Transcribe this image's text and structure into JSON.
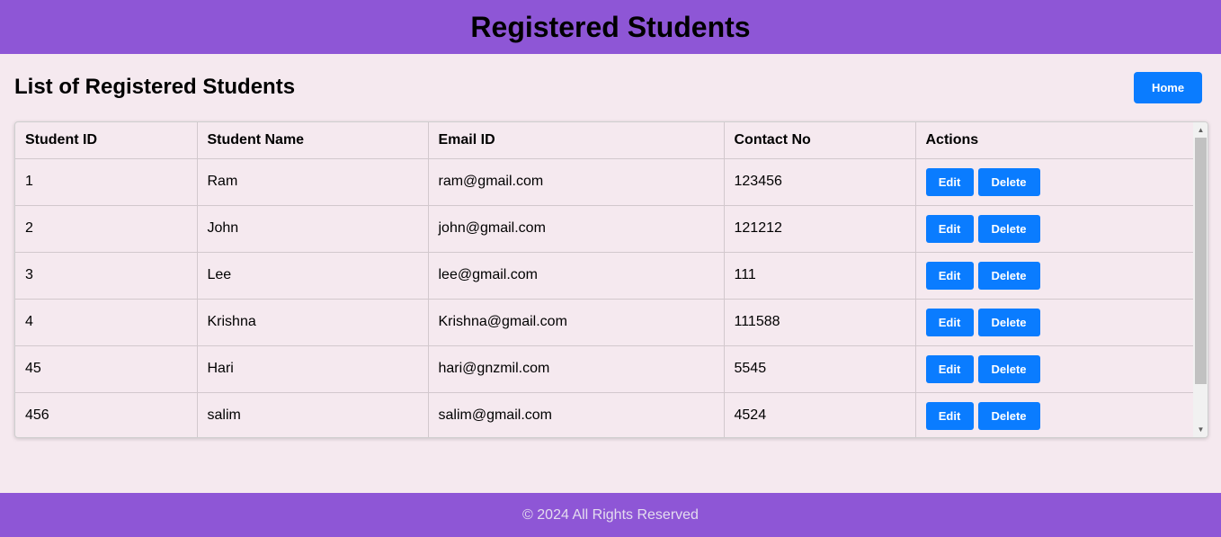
{
  "header": {
    "title": "Registered Students"
  },
  "section": {
    "title": "List of Registered Students",
    "home_label": "Home"
  },
  "table": {
    "columns": [
      "Student ID",
      "Student Name",
      "Email ID",
      "Contact No",
      "Actions"
    ],
    "rows": [
      {
        "id": "1",
        "name": "Ram",
        "email": "ram@gmail.com",
        "contact": "123456"
      },
      {
        "id": "2",
        "name": "John",
        "email": "john@gmail.com",
        "contact": "121212"
      },
      {
        "id": "3",
        "name": "Lee",
        "email": "lee@gmail.com",
        "contact": "111"
      },
      {
        "id": "4",
        "name": "Krishna",
        "email": "Krishna@gmail.com",
        "contact": "111588"
      },
      {
        "id": "45",
        "name": "Hari",
        "email": "hari@gnzmil.com",
        "contact": "5545"
      },
      {
        "id": "456",
        "name": "salim",
        "email": "salim@gmail.com",
        "contact": "4524"
      }
    ],
    "edit_label": "Edit",
    "delete_label": "Delete"
  },
  "footer": {
    "text": "© 2024 All Rights Reserved"
  },
  "colors": {
    "accent": "#8e56d6",
    "button": "#0a7cff",
    "background": "#f5e9ef"
  }
}
